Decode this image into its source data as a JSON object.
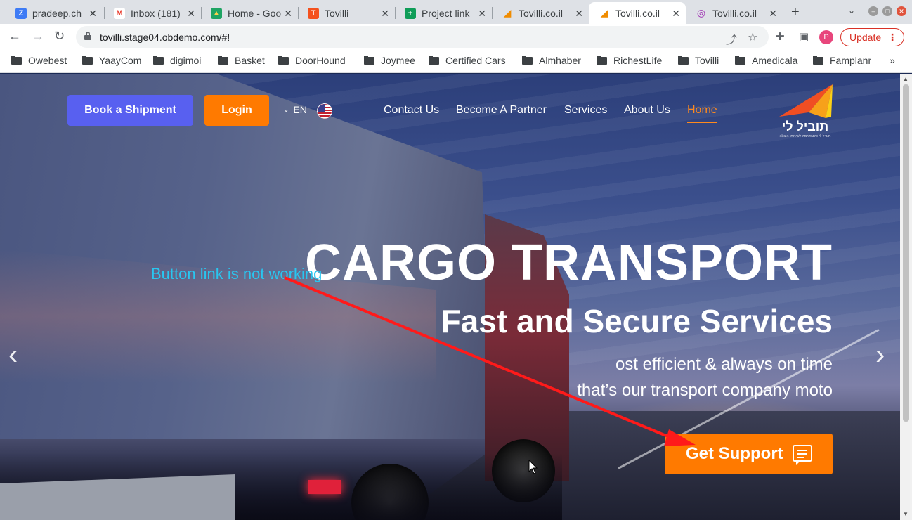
{
  "browser": {
    "tabs": [
      {
        "title": "pradeep.ch",
        "icon": "zoho-icon",
        "color": "#3e7bf5",
        "glyph": "Z"
      },
      {
        "title": "Inbox (181)",
        "icon": "gmail-icon",
        "color": "#e94335",
        "glyph": "M"
      },
      {
        "title": "Home - Goo",
        "icon": "drive-icon",
        "color": "#1fa463",
        "glyph": "▲"
      },
      {
        "title": "Tovilli",
        "icon": "tovilli-icon",
        "color": "#f4511e",
        "glyph": "T"
      },
      {
        "title": "Project link",
        "icon": "sheets-icon",
        "color": "#0f9d58",
        "glyph": "+"
      },
      {
        "title": "Tovilli.co.il",
        "icon": "tovilli-logo-icon",
        "color": "#f08c00",
        "glyph": "◢"
      },
      {
        "title": "Tovilli.co.il",
        "icon": "tovilli-logo-icon",
        "color": "#f08c00",
        "glyph": "◢"
      },
      {
        "title": "Tovilli.co.il",
        "icon": "chrome-icon",
        "color": "#9c27b0",
        "glyph": "◎"
      }
    ],
    "active_tab": 6,
    "new_tab": "+",
    "tab_list": "⌄",
    "url": "tovilli.stage04.obdemo.com/#!",
    "profile_initial": "P",
    "update_label": "Update",
    "bookmarks": [
      "Owebest",
      "YaayCom",
      "digimoi",
      "Basket",
      "DoorHound",
      "Joymee",
      "Certified Cars",
      "Almhaber",
      "RichestLife",
      "Tovilli",
      "Amedicala",
      "Famplanr"
    ],
    "bookmarks_more": "»"
  },
  "site": {
    "book_label": "Book a Shipment",
    "login_label": "Login",
    "lang_label": "EN",
    "nav": [
      "Contact Us",
      "Become A Partner",
      "Services",
      "About Us",
      "Home"
    ],
    "logo_text": "תוביל לי",
    "logo_sub": "תוביל לי פלטפורמה לשירותי הובלה",
    "accent": "#ff7a00",
    "primary": "#5860f0"
  },
  "hero": {
    "title": "CARGO TRANSPORT",
    "subtitle": "Fast and Secure Services",
    "line1": "ost efficient & always on time",
    "line2": "that’s our transport company moto",
    "cta_label": "Get Support",
    "prev_arrow": "‹",
    "next_arrow": "›"
  },
  "annotation": {
    "text": "Button link is not working",
    "color": "#29c6f0",
    "arrow_color": "#ff1a1a"
  }
}
